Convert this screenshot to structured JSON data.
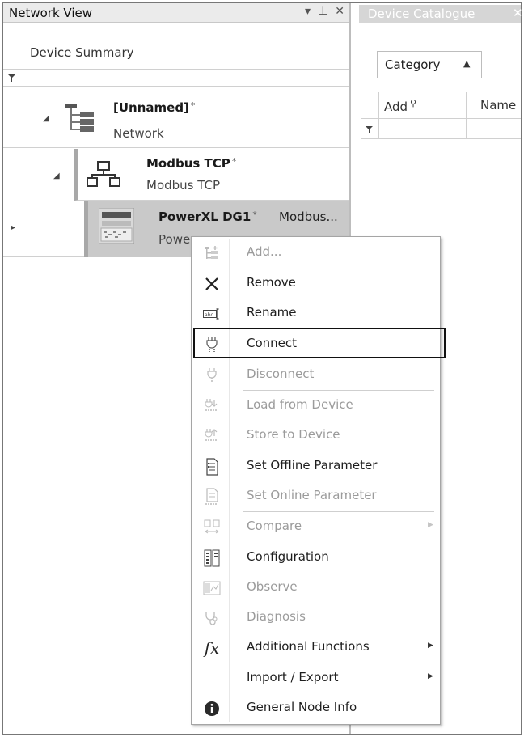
{
  "network_view": {
    "title": "Network View",
    "title_buttons": [
      "▾",
      "⊥",
      "✕"
    ],
    "column_header": "Device Summary",
    "tree": [
      {
        "title": "[Unnamed]",
        "modified": "*",
        "subtitle": "Network",
        "icon": "network-tree-icon",
        "expanded": true
      },
      {
        "title": "Modbus TCP",
        "modified": "*",
        "subtitle": "Modbus TCP",
        "icon": "modbus-network-icon",
        "expanded": true
      },
      {
        "title": "PowerXL DG1",
        "modified": "*",
        "extra": "Modbus...",
        "subtitle": "Power",
        "icon": "drive-device-icon",
        "expanded": false,
        "selected": true
      }
    ]
  },
  "device_catalogue": {
    "tab_title": "Device Catalogue",
    "tab_close": "✕",
    "category_button": "Category",
    "columns": [
      "Add",
      "Name"
    ]
  },
  "context_menu": {
    "items": [
      {
        "label": "Add...",
        "icon": "add-node-icon",
        "enabled": false
      },
      {
        "label": "Remove",
        "icon": "remove-x-icon",
        "enabled": true
      },
      {
        "label": "Rename",
        "icon": "rename-icon",
        "enabled": true
      },
      {
        "label": "Connect",
        "icon": "connect-plug-icon",
        "enabled": true,
        "highlighted": true
      },
      {
        "label": "Disconnect",
        "icon": "disconnect-plug-icon",
        "enabled": false
      },
      {
        "label": "Load from Device",
        "icon": "load-from-device-icon",
        "enabled": false
      },
      {
        "label": "Store to Device",
        "icon": "store-to-device-icon",
        "enabled": false
      },
      {
        "label": "Set Offline Parameter",
        "icon": "offline-parameter-icon",
        "enabled": true
      },
      {
        "label": "Set Online Parameter",
        "icon": "online-parameter-icon",
        "enabled": false
      },
      {
        "label": "Compare",
        "icon": "compare-icon",
        "enabled": false,
        "submenu": true
      },
      {
        "label": "Configuration",
        "icon": "configuration-icon",
        "enabled": true
      },
      {
        "label": "Observe",
        "icon": "observe-icon",
        "enabled": false
      },
      {
        "label": "Diagnosis",
        "icon": "diagnosis-icon",
        "enabled": false
      },
      {
        "label": "Additional Functions",
        "icon": "fx-functions-icon",
        "enabled": true,
        "submenu": true
      },
      {
        "label": "Import / Export",
        "icon": "",
        "enabled": true,
        "submenu": true
      },
      {
        "label": "General Node Info",
        "icon": "info-icon",
        "enabled": true
      }
    ]
  },
  "colors": {
    "selected_row": "#c9c9c9",
    "tree_connector": "#a8a8a8",
    "disabled_text": "#9b9b9b",
    "tab_inactive": "#d6d6d6"
  }
}
